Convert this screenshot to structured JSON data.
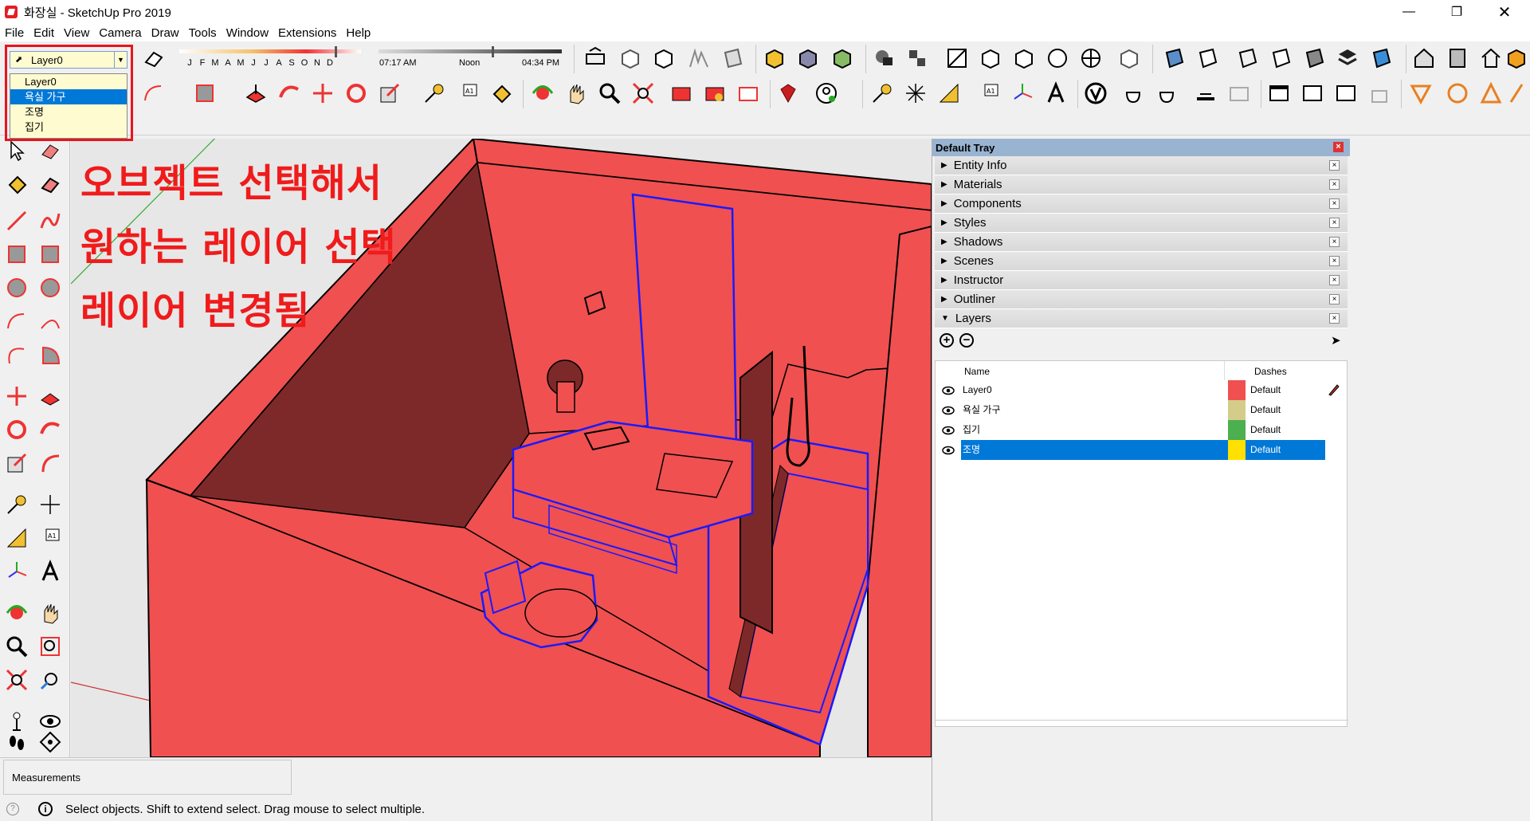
{
  "window": {
    "title": "화장실 - SketchUp Pro 2019"
  },
  "menu": [
    "File",
    "Edit",
    "View",
    "Camera",
    "Draw",
    "Tools",
    "Window",
    "Extensions",
    "Help"
  ],
  "layer_dropdown": {
    "current": "Layer0",
    "options": [
      "Layer0",
      "욕실 가구",
      "조명",
      "집기"
    ],
    "highlighted": "욕실 가구"
  },
  "shadow_settings": {
    "months": [
      "J",
      "F",
      "M",
      "A",
      "M",
      "J",
      "J",
      "A",
      "S",
      "O",
      "N",
      "D"
    ],
    "time_start": "07:17 AM",
    "time_mid": "Noon",
    "time_end": "04:34 PM"
  },
  "annotations": [
    "오브젝트 선택해서",
    "원하는 레이어 선택",
    "레이어 변경됨"
  ],
  "tray": {
    "title": "Default Tray",
    "panels": [
      "Entity Info",
      "Materials",
      "Components",
      "Styles",
      "Shadows",
      "Scenes",
      "Instructor",
      "Outliner",
      "Layers"
    ],
    "layers_table": {
      "col_name": "Name",
      "col_dashes": "Dashes",
      "rows": [
        {
          "name": "Layer0",
          "color": "#f05050",
          "dashes": "Default",
          "selected": false,
          "active": true
        },
        {
          "name": "욕실 가구",
          "color": "#d4cc8a",
          "dashes": "Default",
          "selected": false,
          "active": false
        },
        {
          "name": "집기",
          "color": "#4caf50",
          "dashes": "Default",
          "selected": false,
          "active": false
        },
        {
          "name": "조명",
          "color": "#ffe000",
          "dashes": "Default",
          "selected": true,
          "active": false
        }
      ]
    }
  },
  "measurements_label": "Measurements",
  "status_text": "Select objects. Shift to extend select. Drag mouse to select multiple.",
  "colors": {
    "wall": "#f05050",
    "wall_dark": "#7e2929",
    "selection": "#1a1aff",
    "annotation": "#f01b1b"
  }
}
